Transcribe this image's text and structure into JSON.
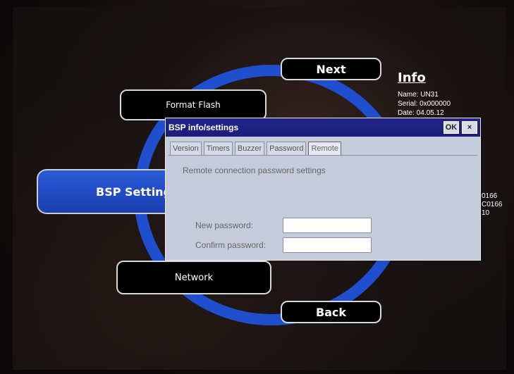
{
  "menu": {
    "next": "Next",
    "format_flash": "Format Flash",
    "bsp_settings": "BSP Setting",
    "network": "Network",
    "back": "Back"
  },
  "info": {
    "title": "Info",
    "name": "Name: UN31",
    "serial": "Serial: 0x000000",
    "date": "Date: 04.05.12",
    "values": [
      "0166",
      "C0166",
      "10"
    ]
  },
  "dialog": {
    "title": "BSP info/settings",
    "ok_label": "OK",
    "close_label": "×",
    "tabs": [
      {
        "label": "Version",
        "active": false
      },
      {
        "label": "Timers",
        "active": false
      },
      {
        "label": "Buzzer",
        "active": false
      },
      {
        "label": "Password",
        "active": false
      },
      {
        "label": "Remote",
        "active": true
      }
    ],
    "heading": "Remote connection password settings",
    "new_password_label": "New password:",
    "confirm_password_label": "Confirm password:",
    "new_password_value": "",
    "confirm_password_value": ""
  },
  "colors": {
    "accent": "#1f4fcf",
    "titlebar": "#1b1d78",
    "dialog_bg": "#c6cbdc"
  }
}
